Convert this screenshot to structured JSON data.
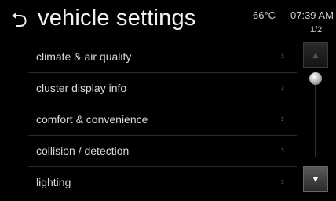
{
  "header": {
    "back_icon": "back-arrow-icon",
    "title": "vehicle settings",
    "temperature": "66°C",
    "time": "07:39 AM",
    "page_indicator": "1/2"
  },
  "menu": {
    "items": [
      {
        "label": "climate & air quality"
      },
      {
        "label": "cluster display info"
      },
      {
        "label": "comfort & convenience"
      },
      {
        "label": "collision / detection"
      },
      {
        "label": "lighting"
      }
    ],
    "chevron": "›"
  },
  "scroll": {
    "up_icon": "up-arrow-icon",
    "down_icon": "down-arrow-icon",
    "up_glyph": "▲",
    "down_glyph": "▼"
  }
}
